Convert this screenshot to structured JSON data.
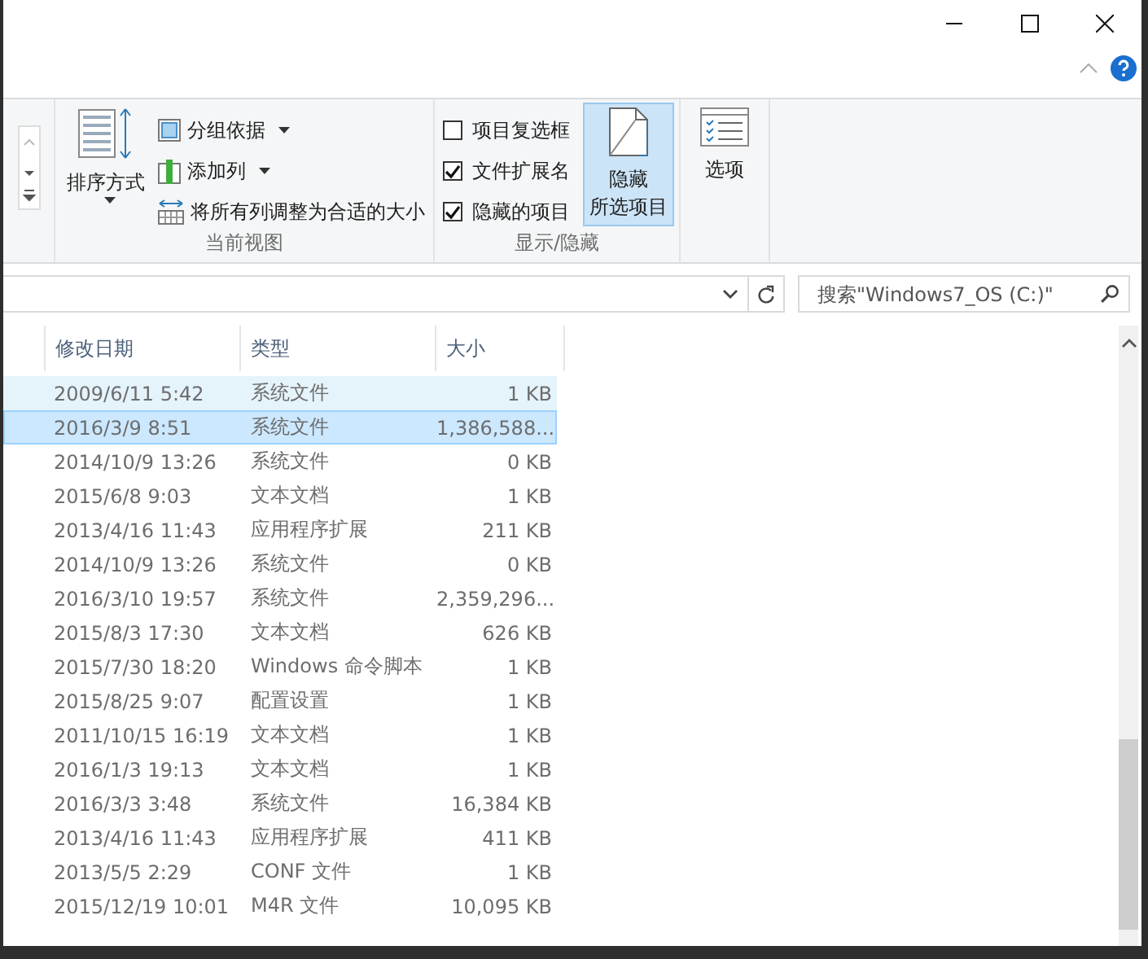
{
  "ribbon": {
    "groups": [
      {
        "kind": "view",
        "label": "当前视图",
        "large_button": {
          "label": "排序方式",
          "dropdown": true
        },
        "small_buttons": [
          {
            "label": "分组依据",
            "dropdown": true
          },
          {
            "label": "添加列",
            "dropdown": true
          },
          {
            "label": "将所有列调整为合适的大小",
            "dropdown": false
          }
        ]
      },
      {
        "kind": "showhide",
        "label": "显示/隐藏",
        "checkboxes": [
          {
            "label": "项目复选框",
            "checked": false
          },
          {
            "label": "文件扩展名",
            "checked": true
          },
          {
            "label": "隐藏的项目",
            "checked": true
          }
        ],
        "large_button": {
          "lines": [
            "隐藏",
            "所选项目"
          ],
          "selected": true
        }
      },
      {
        "kind": "options",
        "large_button": {
          "label": "选项"
        }
      }
    ]
  },
  "address": {
    "search": {
      "placeholder": "搜索\"Windows7_OS (C:)\""
    }
  },
  "files": {
    "columns": [
      "修改日期",
      "类型",
      "大小"
    ],
    "rows": [
      {
        "date": "2009/6/11 5:42",
        "type": "系统文件",
        "size": "1 KB",
        "selected": false,
        "hovered": true
      },
      {
        "date": "2016/3/9 8:51",
        "type": "系统文件",
        "size": "1,386,588...",
        "selected": true,
        "hovered": false
      },
      {
        "date": "2014/10/9 13:26",
        "type": "系统文件",
        "size": "0 KB",
        "selected": false,
        "hovered": false
      },
      {
        "date": "2015/6/8 9:03",
        "type": "文本文档",
        "size": "1 KB",
        "selected": false,
        "hovered": false
      },
      {
        "date": "2013/4/16 11:43",
        "type": "应用程序扩展",
        "size": "211 KB",
        "selected": false,
        "hovered": false
      },
      {
        "date": "2014/10/9 13:26",
        "type": "系统文件",
        "size": "0 KB",
        "selected": false,
        "hovered": false
      },
      {
        "date": "2016/3/10 19:57",
        "type": "系统文件",
        "size": "2,359,296...",
        "selected": false,
        "hovered": false
      },
      {
        "date": "2015/8/3 17:30",
        "type": "文本文档",
        "size": "626 KB",
        "selected": false,
        "hovered": false
      },
      {
        "date": "2015/7/30 18:20",
        "type": "Windows 命令脚本",
        "size": "1 KB",
        "selected": false,
        "hovered": false
      },
      {
        "date": "2015/8/25 9:07",
        "type": "配置设置",
        "size": "1 KB",
        "selected": false,
        "hovered": false
      },
      {
        "date": "2011/10/15 16:19",
        "type": "文本文档",
        "size": "1 KB",
        "selected": false,
        "hovered": false
      },
      {
        "date": "2016/1/3 19:13",
        "type": "文本文档",
        "size": "1 KB",
        "selected": false,
        "hovered": false
      },
      {
        "date": "2016/3/3 3:48",
        "type": "系统文件",
        "size": "16,384 KB",
        "selected": false,
        "hovered": false
      },
      {
        "date": "2013/4/16 11:43",
        "type": "应用程序扩展",
        "size": "411 KB",
        "selected": false,
        "hovered": false
      },
      {
        "date": "2013/5/5 2:29",
        "type": "CONF 文件",
        "size": "1 KB",
        "selected": false,
        "hovered": false
      },
      {
        "date": "2015/12/19 10:01",
        "type": "M4R 文件",
        "size": "10,095 KB",
        "selected": false,
        "hovered": false
      }
    ]
  }
}
